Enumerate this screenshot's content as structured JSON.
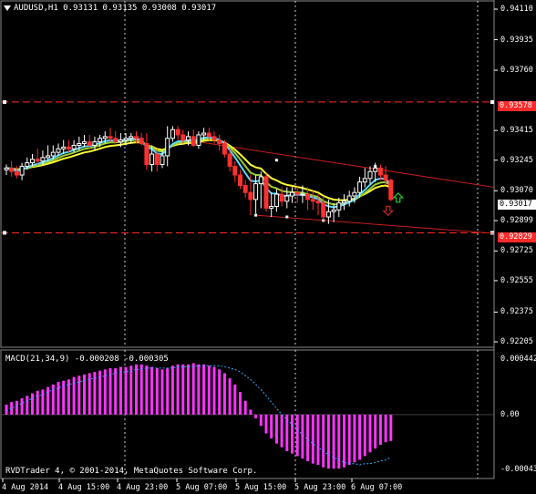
{
  "header": {
    "symbol_info": "AUDUSD,H1  0.93131 0.93135 0.93008 0.93017"
  },
  "colors": {
    "background": "#000000",
    "bull_candle": "#ffffff",
    "bear_candle": "#ff3030",
    "ma_fast": "#5ad8ff",
    "ma_slow": "#ffff33",
    "ma_mid": "#9acd32",
    "hline": "#ff2a2a",
    "channel": "#c81e1e",
    "histogram": "#ff33ff",
    "signal": "#33aaff",
    "grid": "#ffffff",
    "up_arrow": "#22cc22",
    "down_arrow": "#cc2222"
  },
  "price_axis": {
    "labels": [
      "0.94110",
      "0.93935",
      "0.93760",
      "0.93415",
      "0.93245",
      "0.93070",
      "0.92899",
      "0.92725",
      "0.92555",
      "0.92375",
      "0.92205"
    ],
    "current_price": "0.93017",
    "upper_level": "0.93578",
    "lower_level": "0.92829"
  },
  "time_axis": {
    "labels": [
      "4 Aug 2014",
      "4 Aug 15:00",
      "4 Aug 23:00",
      "5 Aug 07:00",
      "5 Aug 15:00",
      "5 Aug 23:00",
      "6 Aug 07:00"
    ]
  },
  "macd": {
    "title": "MACD(21,34,9) -0.000208 -0.000305",
    "axis_labels": [
      "0.000442",
      "0.00",
      "-0.000436"
    ]
  },
  "footer": {
    "copyright": "RVDTrader 4, © 2001-2014, MetaQuotes Software Corp."
  },
  "chart_data": {
    "type": "candlestick",
    "title": "AUDUSD,H1",
    "ylim": [
      0.92205,
      0.9411
    ],
    "open": [
      0.9319,
      0.932,
      0.9318,
      0.9316,
      0.9321,
      0.9323,
      0.9325,
      0.9324,
      0.9326,
      0.9327,
      0.9329,
      0.9331,
      0.9332,
      0.9331,
      0.9333,
      0.9334,
      0.9335,
      0.9333,
      0.9335,
      0.9337,
      0.9338,
      0.9337,
      0.9335,
      0.9336,
      0.9337,
      0.9338,
      0.9337,
      0.9334,
      0.9322,
      0.9328,
      0.9322,
      0.9327,
      0.9337,
      0.9342,
      0.9339,
      0.9336,
      0.9338,
      0.9333,
      0.9339,
      0.934,
      0.9338,
      0.9336,
      0.9334,
      0.9328,
      0.9321,
      0.9316,
      0.931,
      0.9306,
      0.9302,
      0.9311,
      0.9315,
      0.9297,
      0.9298,
      0.9305,
      0.9301,
      0.9304,
      0.9306,
      0.9305,
      0.9305,
      0.9302,
      0.9301,
      0.93,
      0.9292,
      0.9295,
      0.9296,
      0.93,
      0.9301,
      0.9304,
      0.9306,
      0.9312,
      0.9314,
      0.9318,
      0.932,
      0.9316,
      0.9313
    ],
    "high": [
      0.9322,
      0.9324,
      0.9321,
      0.9323,
      0.9326,
      0.9328,
      0.9331,
      0.933,
      0.9333,
      0.9333,
      0.9334,
      0.9336,
      0.9336,
      0.9336,
      0.9338,
      0.9339,
      0.9339,
      0.9338,
      0.9339,
      0.9341,
      0.9343,
      0.9341,
      0.934,
      0.934,
      0.934,
      0.9341,
      0.934,
      0.934,
      0.9333,
      0.9331,
      0.933,
      0.9344,
      0.9344,
      0.9344,
      0.9342,
      0.9341,
      0.9342,
      0.9341,
      0.9343,
      0.9343,
      0.9341,
      0.9339,
      0.9336,
      0.9331,
      0.9324,
      0.9319,
      0.9313,
      0.9316,
      0.9316,
      0.9318,
      0.9317,
      0.9306,
      0.9308,
      0.9309,
      0.9309,
      0.9309,
      0.931,
      0.931,
      0.9309,
      0.9307,
      0.9305,
      0.9304,
      0.9302,
      0.93,
      0.9303,
      0.9305,
      0.9307,
      0.9309,
      0.9315,
      0.932,
      0.9321,
      0.9323,
      0.9322,
      0.9321,
      0.9314
    ],
    "low": [
      0.9316,
      0.9315,
      0.9314,
      0.9313,
      0.9319,
      0.9321,
      0.9322,
      0.9322,
      0.9324,
      0.9325,
      0.9327,
      0.9328,
      0.9329,
      0.9329,
      0.933,
      0.9332,
      0.9331,
      0.933,
      0.9332,
      0.9334,
      0.9335,
      0.9334,
      0.9332,
      0.9333,
      0.9334,
      0.9334,
      0.9333,
      0.9319,
      0.9318,
      0.9318,
      0.932,
      0.9321,
      0.9335,
      0.9336,
      0.9334,
      0.9333,
      0.9332,
      0.9331,
      0.9336,
      0.9335,
      0.9334,
      0.933,
      0.9326,
      0.9318,
      0.9312,
      0.9308,
      0.9303,
      0.9293,
      0.9294,
      0.9297,
      0.9295,
      0.9292,
      0.9295,
      0.9298,
      0.9297,
      0.93,
      0.93,
      0.93,
      0.9296,
      0.9296,
      0.9293,
      0.929,
      0.9288,
      0.9289,
      0.9292,
      0.9296,
      0.9298,
      0.93,
      0.9303,
      0.9309,
      0.9311,
      0.9312,
      0.9313,
      0.931,
      0.9301
    ],
    "close": [
      0.932,
      0.9318,
      0.9316,
      0.9321,
      0.9323,
      0.9325,
      0.9324,
      0.9326,
      0.9327,
      0.9329,
      0.9331,
      0.9332,
      0.9331,
      0.9333,
      0.9334,
      0.9335,
      0.9333,
      0.9335,
      0.9337,
      0.9338,
      0.9337,
      0.9335,
      0.9336,
      0.9337,
      0.9338,
      0.9337,
      0.9334,
      0.9322,
      0.9328,
      0.9322,
      0.9327,
      0.9337,
      0.9342,
      0.9339,
      0.9336,
      0.9338,
      0.9333,
      0.9339,
      0.934,
      0.9338,
      0.9336,
      0.9334,
      0.9328,
      0.9321,
      0.9316,
      0.931,
      0.9306,
      0.9302,
      0.9311,
      0.9315,
      0.9297,
      0.9298,
      0.9305,
      0.9301,
      0.9304,
      0.9306,
      0.9305,
      0.9305,
      0.9302,
      0.9301,
      0.93,
      0.9292,
      0.9295,
      0.9296,
      0.93,
      0.9301,
      0.9304,
      0.9306,
      0.9312,
      0.9314,
      0.9318,
      0.932,
      0.9316,
      0.9313,
      0.9302
    ],
    "macd_hist": [
      8e-05,
      0.0001,
      0.00011,
      0.00013,
      0.00015,
      0.00017,
      0.00019,
      0.0002,
      0.00022,
      0.00024,
      0.00026,
      0.00027,
      0.00028,
      0.0003,
      0.00031,
      0.00032,
      0.00033,
      0.00034,
      0.00035,
      0.00036,
      0.00037,
      0.00037,
      0.00038,
      0.00038,
      0.00039,
      0.0004,
      0.0004,
      0.00039,
      0.00038,
      0.00037,
      0.00036,
      0.00037,
      0.00039,
      0.0004,
      0.0004,
      0.0004,
      0.00041,
      0.0004,
      0.0004,
      0.00039,
      0.00038,
      0.00036,
      0.00033,
      0.00029,
      0.00024,
      0.00018,
      0.00011,
      4e-05,
      -3e-05,
      -9e-05,
      -0.00015,
      -0.00019,
      -0.00023,
      -0.00026,
      -0.00029,
      -0.00031,
      -0.00033,
      -0.00035,
      -0.00037,
      -0.00039,
      -0.0004,
      -0.00042,
      -0.00043,
      -0.00043,
      -0.00043,
      -0.00042,
      -0.0004,
      -0.00038,
      -0.00036,
      -0.00033,
      -0.0003,
      -0.00027,
      -0.00024,
      -0.00022,
      -0.00021
    ],
    "macd_signal": [
      3e-05,
      5e-05,
      7e-05,
      9e-05,
      0.00011,
      0.00013,
      0.00015,
      0.00016,
      0.00018,
      0.0002,
      0.00021,
      0.00023,
      0.00024,
      0.00025,
      0.00026,
      0.00027,
      0.00028,
      0.00029,
      0.0003,
      0.00031,
      0.00032,
      0.00033,
      0.00034,
      0.00034,
      0.00035,
      0.00036,
      0.00036,
      0.00037,
      0.00037,
      0.00037,
      0.00037,
      0.00037,
      0.00037,
      0.00038,
      0.00038,
      0.00038,
      0.00038,
      0.00039,
      0.00039,
      0.00039,
      0.00039,
      0.00039,
      0.00038,
      0.00037,
      0.00036,
      0.00034,
      0.00031,
      0.00028,
      0.00024,
      0.0002,
      0.00015,
      0.0001,
      5e-05,
      0.0,
      -4e-05,
      -8e-05,
      -0.00012,
      -0.00016,
      -0.0002,
      -0.00023,
      -0.00026,
      -0.00029,
      -0.00032,
      -0.00034,
      -0.00036,
      -0.00038,
      -0.00039,
      -0.00039,
      -0.0004,
      -0.00039,
      -0.00039,
      -0.00038,
      -0.00037,
      -0.00036,
      -0.00034
    ],
    "macd_ylim": [
      -0.000436,
      0.000442
    ],
    "hlines": [
      0.93578,
      0.92829
    ]
  }
}
